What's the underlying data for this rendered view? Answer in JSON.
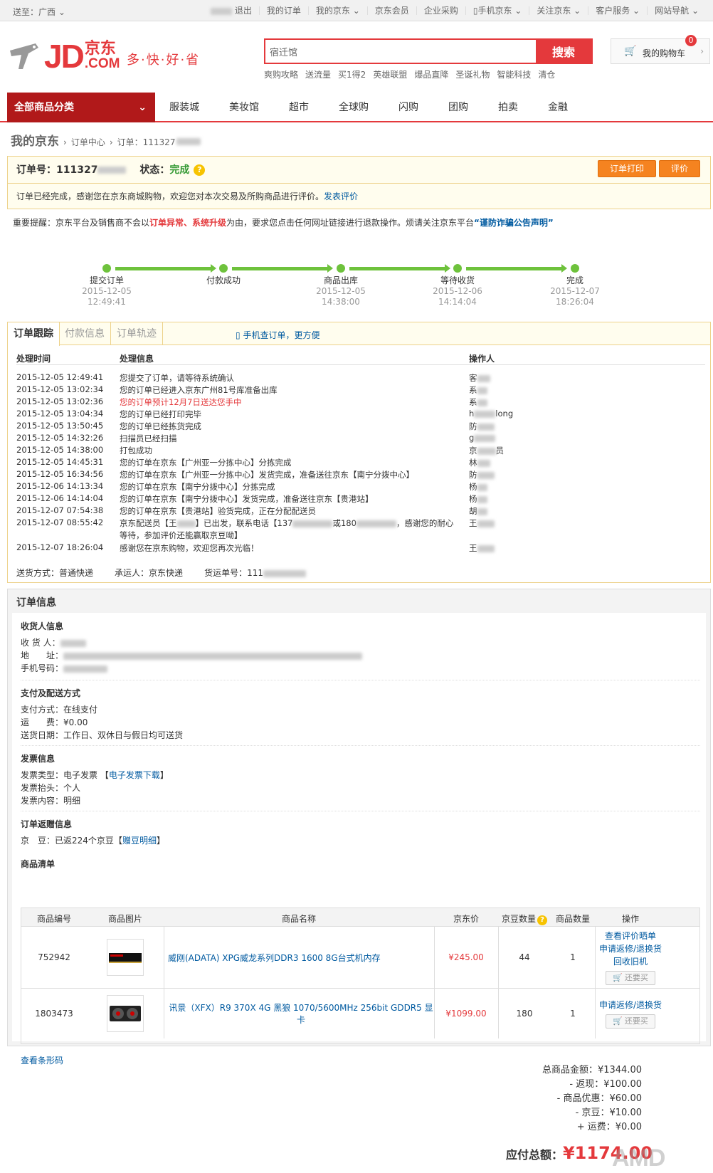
{
  "topbar": {
    "location": "送至：广西",
    "links": [
      "退出",
      "我的订单",
      "我的京东",
      "京东会员",
      "企业采购",
      "手机京东",
      "关注京东",
      "客户服务",
      "网站导航"
    ]
  },
  "header": {
    "logo_text": "JD",
    "logo_cn": "京东",
    "logo_com": ".COM",
    "slogan": "多·快·好·省",
    "search_value": "宿迁馆",
    "search_button": "搜索",
    "hotwords": [
      "爽购攻略",
      "送流量",
      "买1得2",
      "英雄联盟",
      "爆品直降",
      "圣诞礼物",
      "智能科技",
      "清仓"
    ],
    "cart_label": "我的购物车",
    "cart_count": "0"
  },
  "nav": {
    "all_categories": "全部商品分类",
    "items": [
      "服装城",
      "美妆馆",
      "超市",
      "全球购",
      "闪购",
      "团购",
      "拍卖",
      "金融"
    ]
  },
  "breadcrumb": {
    "title": "我的京东",
    "center": "订单中心",
    "order": "订单：111327"
  },
  "order": {
    "number_label": "订单号：",
    "number": "111327",
    "status_label": "状态：",
    "status": "完成",
    "print_button": "订单打印",
    "review_button": "评价",
    "message": "订单已经完成，感谢您在京东商城购物，欢迎您对本次交易及所购商品进行评价。",
    "review_link": "发表评价"
  },
  "notice": {
    "prefix": "重要提醒：京东平台及销售商不会以",
    "red": "订单异常、系统升级",
    "middle": "为由，要求您点击任何网址链接进行退款操作。烦请关注京东平台",
    "link": "“谨防诈骗公告声明”"
  },
  "progress": [
    {
      "label": "提交订单",
      "date": "2015-12-05",
      "time": "12:49:41"
    },
    {
      "label": "付款成功",
      "date": "",
      "time": ""
    },
    {
      "label": "商品出库",
      "date": "2015-12-05",
      "time": "14:38:00"
    },
    {
      "label": "等待收货",
      "date": "2015-12-06",
      "time": "14:14:04"
    },
    {
      "label": "完成",
      "date": "2015-12-07",
      "time": "18:26:04"
    }
  ],
  "tracking": {
    "tabs": [
      "订单跟踪",
      "付款信息",
      "订单轨迹"
    ],
    "mobile_link": "手机查订单，更方便",
    "headers": [
      "处理时间",
      "处理信息",
      "操作人"
    ],
    "rows": [
      {
        "time": "2015-12-05 12:49:41",
        "info": "您提交了订单，请等待系统确认",
        "op": "客"
      },
      {
        "time": "2015-12-05 13:02:34",
        "info": "您的订单已经进入京东广州81号库准备出库",
        "op": "系"
      },
      {
        "time": "2015-12-05 13:02:36",
        "info": "您的订单预计12月7日送达您手中",
        "op": "系"
      },
      {
        "time": "2015-12-05 13:04:34",
        "info": "您的订单已经打印完毕",
        "op": "h",
        "op_tail": "long"
      },
      {
        "time": "2015-12-05 13:50:45",
        "info": "您的订单已经拣货完成",
        "op": "防"
      },
      {
        "time": "2015-12-05 14:32:26",
        "info": "扫描员已经扫描",
        "op": "g"
      },
      {
        "time": "2015-12-05 14:38:00",
        "info": "打包成功",
        "op": "京",
        "op_tail": "员"
      },
      {
        "time": "2015-12-05 14:45:31",
        "info": "您的订单在京东【广州亚一分拣中心】分拣完成",
        "op": "林"
      },
      {
        "time": "2015-12-05 16:34:56",
        "info": "您的订单在京东【广州亚一分拣中心】发货完成，准备送往京东【南宁分拨中心】",
        "op": "防"
      },
      {
        "time": "2015-12-06 14:13:34",
        "info": "您的订单在京东【南宁分拨中心】分拣完成",
        "op": "杨"
      },
      {
        "time": "2015-12-06 14:14:04",
        "info": "您的订单在京东【南宁分拨中心】发货完成，准备送往京东【贵港站】",
        "op": "杨"
      },
      {
        "time": "2015-12-07 07:54:38",
        "info": "您的订单在京东【贵港站】验货完成，正在分配配送员",
        "op": "胡"
      },
      {
        "time": "2015-12-07 08:55:42",
        "info": "京东配送员【王",
        "info_mid": "】已出发，联系电话【137",
        "info_mid2": "或180",
        "info_tail": "，感谢您的耐心",
        "info2": "等待，参加评价还能赢取京豆呦】",
        "op": "王"
      },
      {
        "time": "2015-12-07 18:26:04",
        "info": "感谢您在京东购物，欢迎您再次光临！",
        "op": "王"
      }
    ],
    "ship_method_label": "送货方式：",
    "ship_method": "普通快递",
    "carrier_label": "承运人：",
    "carrier": "京东快递",
    "tracking_no_label": "货运单号：",
    "tracking_no": "111"
  },
  "info": {
    "title": "订单信息",
    "receiver": {
      "title": "收货人信息",
      "name_label": "收 货 人：",
      "addr_label": "地　　址：",
      "phone_label": "手机号码："
    },
    "payment": {
      "title": "支付及配送方式",
      "pay_label": "支付方式：",
      "pay": "在线支付",
      "fee_label": "运　　费：",
      "fee": "¥0.00",
      "date_label": "送货日期：",
      "date": "工作日、双休日与假日均可送货"
    },
    "invoice": {
      "title": "发票信息",
      "type_label": "发票类型：",
      "type": "电子发票",
      "download": "电子发票下载",
      "head_label": "发票抬头：",
      "head": "个人",
      "content_label": "发票内容：",
      "content": "明细"
    },
    "gift": {
      "title": "订单返赠信息",
      "bean_label": "京　豆：",
      "bean": "已返224个京豆",
      "bean_link": "赠豆明细"
    },
    "products_title": "商品清单",
    "product_headers": [
      "商品编号",
      "商品图片",
      "商品名称",
      "京东价",
      "京豆数量",
      "商品数量",
      "操作"
    ],
    "products": [
      {
        "id": "752942",
        "name": "威刚(ADATA) XPG威龙系列DDR3 1600 8G台式机内存",
        "price": "¥245.00",
        "beans": "44",
        "qty": "1",
        "ops": [
          "查看评价晒单",
          "申请返修/退换货",
          "回收旧机"
        ],
        "buy_again": "还要买"
      },
      {
        "id": "1803473",
        "name": "讯景（XFX）R9 370X 4G 黑狼 1070/5600MHz 256bit GDDR5 显卡",
        "price": "¥1099.00",
        "beans": "180",
        "qty": "1",
        "ops": [
          "申请返修/退换货"
        ],
        "buy_again": "还要买"
      }
    ],
    "barcode_link": "查看条形码"
  },
  "totals": [
    {
      "label": "总商品金额：",
      "value": "¥1344.00"
    },
    {
      "label": "- 返现：",
      "value": "¥100.00"
    },
    {
      "label": "- 商品优惠：",
      "value": "¥60.00"
    },
    {
      "label": "- 京豆：",
      "value": "¥10.00"
    },
    {
      "label": "+ 运费：",
      "value": "¥0.00"
    }
  ],
  "grand_total_label": "应付总额：",
  "grand_total": "¥1174.00",
  "watermark": "AMD"
}
